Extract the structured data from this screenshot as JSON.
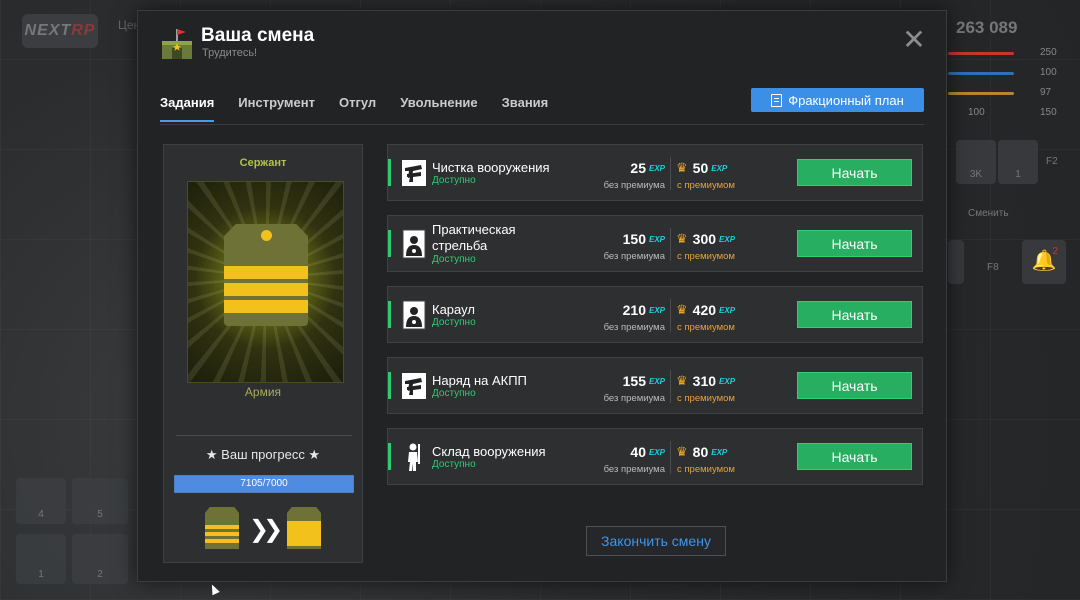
{
  "hud": {
    "logo_a": "NEXT",
    "logo_b": "RP",
    "center_label": "Цен",
    "money": "263 089",
    "stats": [
      "250",
      "100",
      "97",
      "100",
      "150"
    ],
    "slot_3k": "3K",
    "slot_1": "1",
    "slot_f2": "F2",
    "change_label": "Сменить",
    "slot_f8": "F8",
    "notif_count": "2",
    "slots_bottom": [
      "4",
      "5",
      "1",
      "2"
    ]
  },
  "modal": {
    "title": "Ваша смена",
    "subtitle": "Трудитесь!",
    "close_glyph": "✕",
    "tabs": [
      {
        "label": "Задания",
        "active": true
      },
      {
        "label": "Инструмент",
        "active": false
      },
      {
        "label": "Отгул",
        "active": false
      },
      {
        "label": "Увольнение",
        "active": false
      },
      {
        "label": "Звания",
        "active": false
      }
    ],
    "plan_button": "Фракционный план",
    "finish_button": "Закончить смену"
  },
  "rank": {
    "name": "Сержант",
    "faction": "Армия",
    "progress_title": "★ Ваш прогресс ★",
    "progress_text": "7105/7000",
    "progress_fraction": 1.0
  },
  "tasks_meta": {
    "exp": "EXP",
    "crown": "♛",
    "base_label": "без премиума",
    "prem_label": "с премиумом",
    "start_label": "Начать"
  },
  "tasks": [
    {
      "name_1": "Чистка вооружения",
      "name_2": "",
      "status": "Доступно",
      "base": "25",
      "prem": "50",
      "icon": "gun-icon"
    },
    {
      "name_1": "Практическая",
      "name_2": "стрельба",
      "status": "Доступно",
      "base": "150",
      "prem": "300",
      "icon": "target-icon"
    },
    {
      "name_1": "Караул",
      "name_2": "",
      "status": "Доступно",
      "base": "210",
      "prem": "420",
      "icon": "target-icon"
    },
    {
      "name_1": "Наряд на АКПП",
      "name_2": "",
      "status": "Доступно",
      "base": "155",
      "prem": "310",
      "icon": "gun-icon"
    },
    {
      "name_1": "Склад вооружения",
      "name_2": "",
      "status": "Доступно",
      "base": "40",
      "prem": "80",
      "icon": "soldier-icon"
    }
  ],
  "colors": {
    "accent_blue": "#3b8fe6",
    "start_green": "#27ae60",
    "status_green": "#2ecc71",
    "exp_cyan": "#19d3e0",
    "premium_orange": "#e8a23a",
    "rank_yellow": "#f3c11c"
  }
}
